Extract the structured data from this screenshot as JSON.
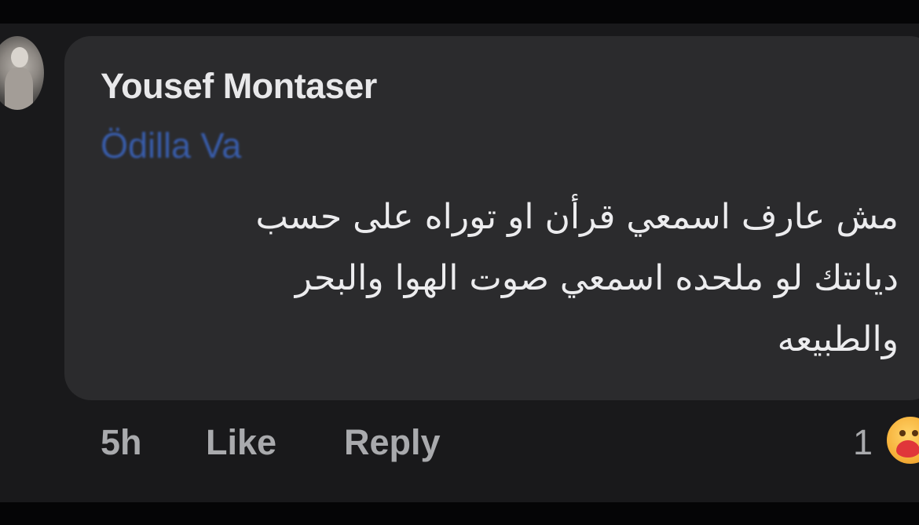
{
  "comment": {
    "author": "Yousef Montaser",
    "mention": "Ödilla Va",
    "text_lines": [
      "مش عارف اسمعي قرأن او توراه على حسب",
      "ديانتك لو ملحده اسمعي صوت الهوا والبحر",
      "والطبيعه"
    ]
  },
  "actions": {
    "time": "5h",
    "like_label": "Like",
    "reply_label": "Reply"
  },
  "reactions": {
    "count": "1",
    "icon": "care-reaction-icon"
  },
  "colors": {
    "background": "#19191b",
    "bubble": "#2b2b2d",
    "mention_link": "#3a62b8",
    "text_primary": "#ececee",
    "text_secondary": "#a9aaad"
  }
}
